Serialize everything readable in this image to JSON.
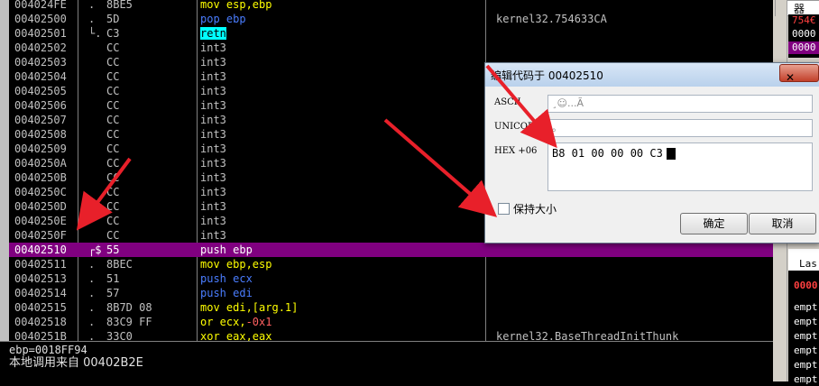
{
  "disasm": {
    "rows": [
      {
        "addr": "004024FE",
        "mark": ".",
        "hex": "8BE5",
        "asm": [
          {
            "t": "mov esp,ebp",
            "c": "yellow"
          }
        ],
        "cmt": ""
      },
      {
        "addr": "00402500",
        "mark": ".",
        "hex": "5D",
        "asm": [
          {
            "t": "pop ebp",
            "c": "blue"
          }
        ],
        "cmt": "kernel32.754633CA"
      },
      {
        "addr": "00402501",
        "mark": "└.",
        "hex": "C3",
        "asm": [
          {
            "t": "retn",
            "c": "ret"
          }
        ],
        "cmt": ""
      },
      {
        "addr": "00402502",
        "mark": "",
        "hex": "CC",
        "asm": [
          {
            "t": "int3",
            "c": ""
          }
        ],
        "cmt": ""
      },
      {
        "addr": "00402503",
        "mark": "",
        "hex": "CC",
        "asm": [
          {
            "t": "int3",
            "c": ""
          }
        ],
        "cmt": ""
      },
      {
        "addr": "00402504",
        "mark": "",
        "hex": "CC",
        "asm": [
          {
            "t": "int3",
            "c": ""
          }
        ],
        "cmt": ""
      },
      {
        "addr": "00402505",
        "mark": "",
        "hex": "CC",
        "asm": [
          {
            "t": "int3",
            "c": ""
          }
        ],
        "cmt": ""
      },
      {
        "addr": "00402506",
        "mark": "",
        "hex": "CC",
        "asm": [
          {
            "t": "int3",
            "c": ""
          }
        ],
        "cmt": ""
      },
      {
        "addr": "00402507",
        "mark": "",
        "hex": "CC",
        "asm": [
          {
            "t": "int3",
            "c": ""
          }
        ],
        "cmt": ""
      },
      {
        "addr": "00402508",
        "mark": "",
        "hex": "CC",
        "asm": [
          {
            "t": "int3",
            "c": ""
          }
        ],
        "cmt": ""
      },
      {
        "addr": "00402509",
        "mark": "",
        "hex": "CC",
        "asm": [
          {
            "t": "int3",
            "c": ""
          }
        ],
        "cmt": ""
      },
      {
        "addr": "0040250A",
        "mark": "",
        "hex": "CC",
        "asm": [
          {
            "t": "int3",
            "c": ""
          }
        ],
        "cmt": ""
      },
      {
        "addr": "0040250B",
        "mark": "",
        "hex": "CC",
        "asm": [
          {
            "t": "int3",
            "c": ""
          }
        ],
        "cmt": ""
      },
      {
        "addr": "0040250C",
        "mark": "",
        "hex": "CC",
        "asm": [
          {
            "t": "int3",
            "c": ""
          }
        ],
        "cmt": ""
      },
      {
        "addr": "0040250D",
        "mark": "",
        "hex": "CC",
        "asm": [
          {
            "t": "int3",
            "c": ""
          }
        ],
        "cmt": ""
      },
      {
        "addr": "0040250E",
        "mark": "",
        "hex": "CC",
        "asm": [
          {
            "t": "int3",
            "c": ""
          }
        ],
        "cmt": ""
      },
      {
        "addr": "0040250F",
        "mark": "",
        "hex": "CC",
        "asm": [
          {
            "t": "int3",
            "c": ""
          }
        ],
        "cmt": ""
      },
      {
        "addr": "00402510",
        "mark": "┌$",
        "hex": "55",
        "asm": [
          {
            "t": "push ebp",
            "c": "blue"
          }
        ],
        "cmt": "",
        "sel": true
      },
      {
        "addr": "00402511",
        "mark": ".",
        "hex": "8BEC",
        "asm": [
          {
            "t": "mov ebp,esp",
            "c": "yellow"
          }
        ],
        "cmt": ""
      },
      {
        "addr": "00402513",
        "mark": ".",
        "hex": "51",
        "asm": [
          {
            "t": "push ecx",
            "c": "blue"
          }
        ],
        "cmt": ""
      },
      {
        "addr": "00402514",
        "mark": ".",
        "hex": "57",
        "asm": [
          {
            "t": "push edi",
            "c": "blue"
          }
        ],
        "cmt": ""
      },
      {
        "addr": "00402515",
        "mark": ".",
        "hex": "8B7D 08",
        "asm": [
          {
            "t": "mov edi,[arg.1]",
            "c": "yellow"
          }
        ],
        "cmt": ""
      },
      {
        "addr": "00402518",
        "mark": ".",
        "hex": "83C9 FF",
        "asm": [
          {
            "t": "or ecx,",
            "c": "yellow"
          },
          {
            "t": "-0x1",
            "c": "red"
          }
        ],
        "cmt": ""
      },
      {
        "addr": "0040251B",
        "mark": ".",
        "hex": "33C0",
        "asm": [
          {
            "t": "xor eax,eax",
            "c": "yellow"
          }
        ],
        "cmt": "kernel32.BaseThreadInitThunk"
      }
    ]
  },
  "info": {
    "line1": "ebp=0018FF94",
    "line2": "本地调用来自 00402B2E"
  },
  "right_panel": {
    "top_label": "器",
    "lines": [
      {
        "t": "754€",
        "c": "#ff4040"
      },
      {
        "t": "0000",
        "c": "#ffffff"
      },
      {
        "t": "0000",
        "c": "#ffffff"
      }
    ],
    "last_label": "Las",
    "red_value": "0000",
    "empty_items": [
      "empt",
      "empt",
      "empt",
      "empt",
      "empt",
      "empt"
    ]
  },
  "dialog": {
    "title": "编辑代码于 00402510",
    "close_label": "✕",
    "ascii_label": "ASCII",
    "ascii_value": "¸☺...Ã",
    "unicode_label": "UNICODE",
    "unicode_value": "。",
    "hex_label": "HEX +06",
    "hex_value": "B8 01 00 00 00 C3",
    "keep_size_label": "保持大小",
    "ok_label": "确定",
    "cancel_label": "取消"
  },
  "colors": {
    "selection": "#800080",
    "arrow": "#e8202a",
    "retn_bg": "#00ffff"
  }
}
